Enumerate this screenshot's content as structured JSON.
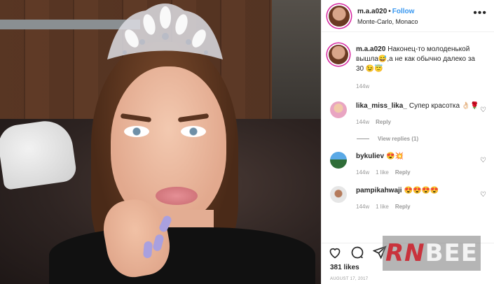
{
  "header": {
    "username": "m.a.a020",
    "separator": "•",
    "follow_label": "Follow",
    "location": "Monte-Carlo, Monaco",
    "more_icon": "more-horizontal-icon"
  },
  "caption": {
    "username": "m.a.a020",
    "text": "Наконец-то молоденькой вышла😅,а не как обычно далеко за 30 😉😇",
    "time": "144w"
  },
  "comments": [
    {
      "username": "lika_miss_lika_",
      "text": "Супер красотка 👌🏻🌹",
      "time": "144w",
      "reply_label": "Reply",
      "view_replies": "View replies (1)"
    },
    {
      "username": "bykuliev",
      "text": "😍💥",
      "time": "144w",
      "likes": "1 like",
      "reply_label": "Reply"
    },
    {
      "username": "pampikahwaji",
      "text": "😍😍😍😍",
      "time": "144w",
      "likes": "1 like",
      "reply_label": "Reply"
    }
  ],
  "footer": {
    "likes": "381 likes",
    "date": "AUGUST 17, 2017"
  },
  "watermark": {
    "part_a": "RN",
    "part_b": "BEE"
  },
  "colors": {
    "accent_link": "#3897f0",
    "text": "#262626",
    "muted": "#999999"
  }
}
